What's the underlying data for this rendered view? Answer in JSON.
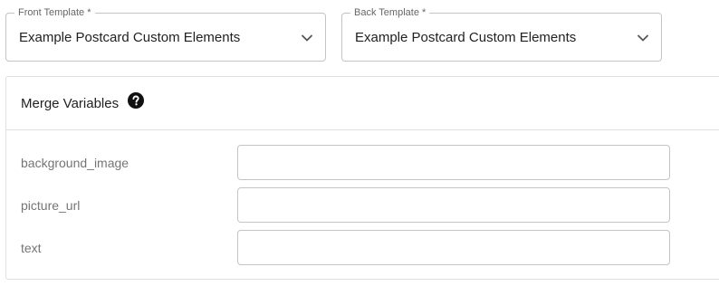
{
  "front_template": {
    "label": "Front Template *",
    "value": "Example Postcard Custom Elements",
    "icon": "chevron-down-icon"
  },
  "back_template": {
    "label": "Back Template *",
    "value": "Example Postcard Custom Elements",
    "icon": "chevron-down-icon"
  },
  "merge_variables": {
    "title": "Merge Variables",
    "help_icon": "help-circle-icon",
    "variables": [
      {
        "label": "background_image",
        "value": "",
        "placeholder": ""
      },
      {
        "label": "picture_url",
        "value": "",
        "placeholder": ""
      },
      {
        "label": "text",
        "value": "",
        "placeholder": ""
      }
    ]
  },
  "colors": {
    "border": "#c4c4c4",
    "divider": "#e0e0e0",
    "text_primary": "#212121",
    "text_secondary": "#757575",
    "icon": "#000000"
  }
}
